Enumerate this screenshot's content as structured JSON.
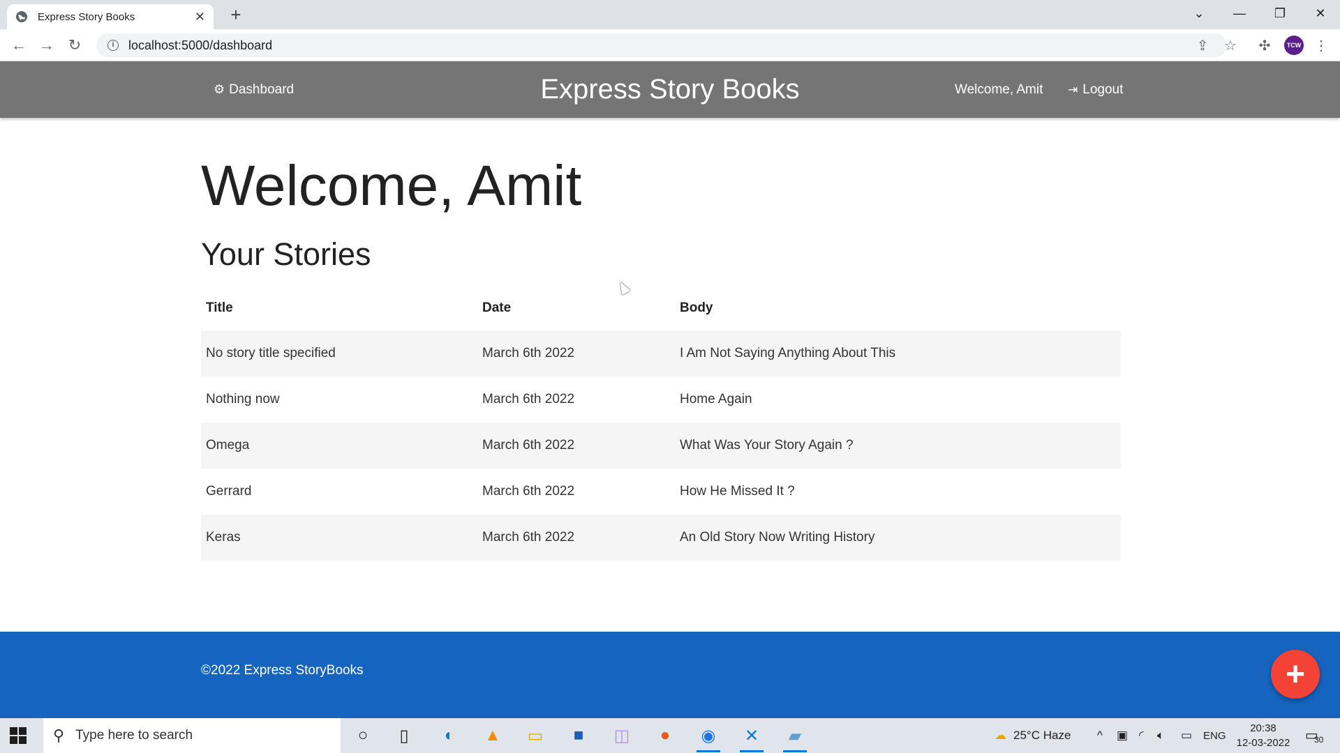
{
  "browser": {
    "tab_title": "Express Story Books",
    "new_tab": "+",
    "close": "✕",
    "url": "localhost:5000/dashboard",
    "avatar_text": "TCW"
  },
  "navbar": {
    "dashboard": "Dashboard",
    "brand": "Express Story Books",
    "welcome": "Welcome, Amit",
    "logout": "Logout"
  },
  "page": {
    "heading": "Welcome, Amit",
    "subheading": "Your Stories"
  },
  "table": {
    "headers": [
      "Title",
      "Date",
      "Body"
    ],
    "rows": [
      {
        "title": "No story title specified",
        "date": "March 6th 2022",
        "body": "I Am Not Saying Anything About This"
      },
      {
        "title": "Nothing now",
        "date": "March 6th 2022",
        "body": "Home Again"
      },
      {
        "title": "Omega",
        "date": "March 6th 2022",
        "body": "What Was Your Story Again ?"
      },
      {
        "title": "Gerrard",
        "date": "March 6th 2022",
        "body": "How He Missed It ?"
      },
      {
        "title": "Keras",
        "date": "March 6th 2022",
        "body": "An Old Story Now Writing History"
      }
    ]
  },
  "footer": {
    "copyright": "©2022 Express StoryBooks",
    "fab": "+"
  },
  "taskbar": {
    "search_placeholder": "Type here to search",
    "weather": "25°C  Haze",
    "lang": "ENG",
    "time": "20:38",
    "date": "12-03-2022",
    "notifications": "30"
  },
  "colors": {
    "navbar": "#757575",
    "footer": "#1565c0",
    "fab": "#f44336"
  }
}
